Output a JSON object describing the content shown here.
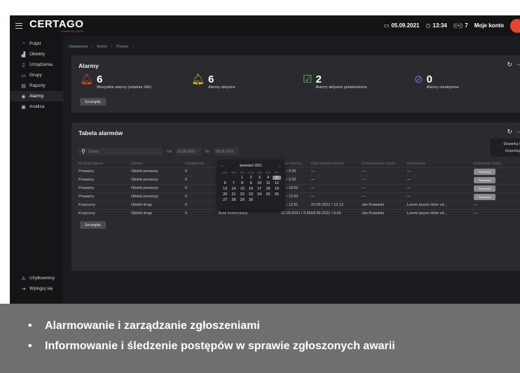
{
  "topbar": {
    "logo": "CERTAGO",
    "logo_sub": "created by SAGIR",
    "date": "05.09.2021",
    "time": "13:34",
    "alarm_count": "7",
    "account": "Moje konto"
  },
  "sidebar": {
    "items": [
      {
        "label": "Pulpit",
        "icon": "dashboard-icon"
      },
      {
        "label": "Obiekty",
        "icon": "bar-chart-icon"
      },
      {
        "label": "Urządzenia",
        "icon": "device-icon"
      },
      {
        "label": "Grupy",
        "icon": "folder-icon"
      },
      {
        "label": "Raporty",
        "icon": "document-icon"
      },
      {
        "label": "Alarmy",
        "icon": "signal-icon",
        "active": true
      },
      {
        "label": "Analiza",
        "icon": "analysis-icon"
      }
    ],
    "bottom": [
      {
        "label": "Użytkownicy",
        "icon": "user-icon"
      },
      {
        "label": "Wyloguj się",
        "icon": "logout-icon"
      }
    ]
  },
  "breadcrumb": [
    "Ustawienia",
    "Konto",
    "Pomoc"
  ],
  "alarms_card": {
    "title": "Alarmy",
    "stats": [
      {
        "value": "6",
        "label": "Wszystkie alarmy (ostatnie 24h)",
        "icon": "bell-icon",
        "color": "#e5462e"
      },
      {
        "value": "6",
        "label": "Alarmy aktywne",
        "icon": "bell-icon",
        "color": "#e8b923"
      },
      {
        "value": "2",
        "label": "Alarmy aktywne potwierdzone",
        "icon": "checkbox-icon",
        "color": "#5fb35a"
      },
      {
        "value": "0",
        "label": "Alarmy nieaktywne",
        "icon": "bell-off-icon",
        "color": "#8d63c4"
      }
    ],
    "details_button": "Szczegóły"
  },
  "table_card": {
    "title": "Tabela alarmów",
    "search_placeholder": "Szukaj",
    "from_label": "Od",
    "from_value": "01.09.2021",
    "to_label": "Do",
    "to_value": "05.09.2021",
    "export": [
      "Eksportuj CSV",
      "Eksportuj xml"
    ],
    "columns": [
      "Rodzaj alarmu",
      "Obiekt",
      "Urządzenie",
      "",
      "Data alarmu",
      "Data potwierdzenia",
      "Potwierdzone przez",
      "Komentarz",
      "Potwierdź alarm"
    ],
    "rows": [
      [
        "Poważny",
        "Obiekt pierwszy",
        "0",
        "",
        "21 / 9:30",
        "—",
        "—",
        "—",
        "Potwierdź"
      ],
      [
        "Poważny",
        "Obiekt pierwszy",
        "0",
        "",
        "21 / 9:30",
        "—",
        "—",
        "—",
        "Potwierdź"
      ],
      [
        "Poważny",
        "Obiekt pierwszy",
        "0",
        "",
        "21 / 18:52",
        "—",
        "—",
        "—",
        "Potwierdź"
      ],
      [
        "Poważny",
        "Obiekt pierwszy",
        "0",
        "",
        "21 / 12:03",
        "—",
        "—",
        "—",
        "Potwierdź"
      ],
      [
        "Krytyczny",
        "Obiekt drugi",
        "0",
        "",
        "21 / 12:51",
        "23.09.2021 / 12:13",
        "Jan Kowalski",
        "Lorem ipsum dolor sit...",
        "—"
      ],
      [
        "Krytyczny",
        "Obiekt drugi",
        "0",
        "Brak komunikacji",
        "02.09.2021 / 6:56",
        "04.09.2021 / 6:56",
        "Jan Kowalski",
        "Lorem ipsum dolor sit...",
        "—"
      ]
    ],
    "details_button": "Szczegóły"
  },
  "calendar": {
    "month": "wrzesień 2021",
    "weekdays": [
      "pon",
      "wto",
      "śro",
      "czw",
      "pią",
      "sob",
      "nie"
    ],
    "days": [
      "",
      "",
      "1",
      "2",
      "3",
      "4",
      "5",
      "6",
      "7",
      "8",
      "9",
      "10",
      "11",
      "12",
      "13",
      "14",
      "15",
      "16",
      "17",
      "18",
      "19",
      "20",
      "21",
      "22",
      "23",
      "24",
      "25",
      "26",
      "27",
      "28",
      "29",
      "30"
    ],
    "selected": "5"
  },
  "banner": {
    "bullets": [
      "Alarmowanie i zarządzanie zgłoszeniami",
      "Informowanie i śledzenie postępów w sprawie zgłoszonych awarii"
    ]
  }
}
